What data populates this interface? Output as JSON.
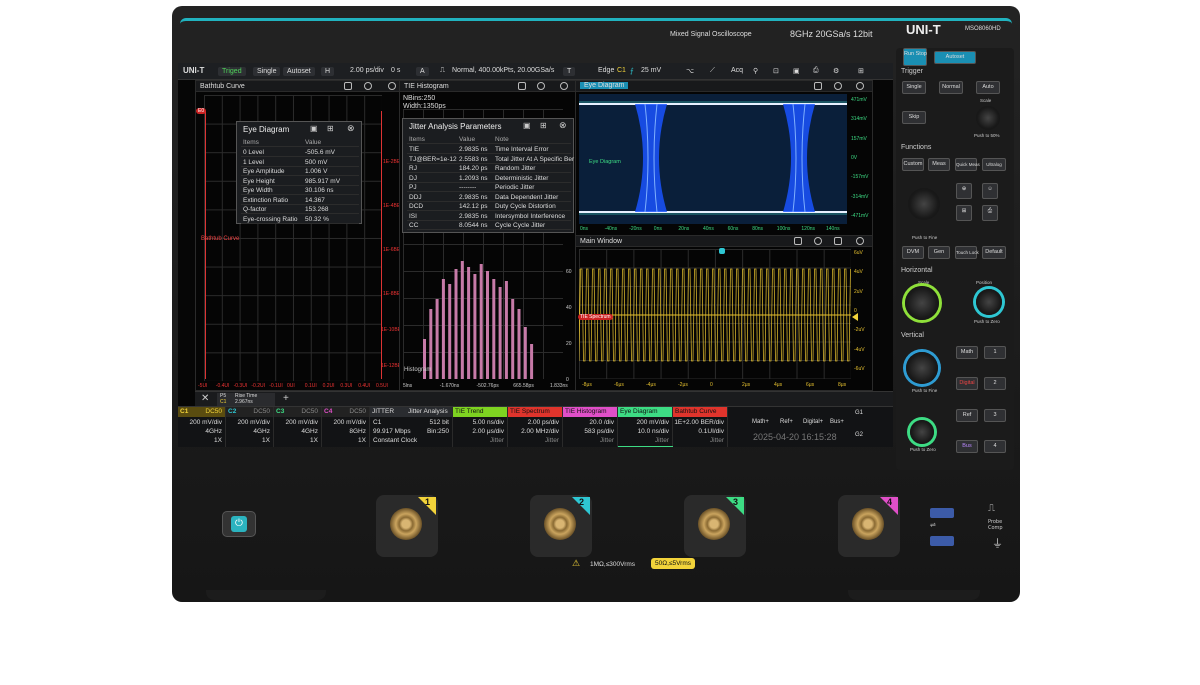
{
  "device": {
    "brand": "UNI-T",
    "model": "MSO8060HD",
    "tagline": "Mixed Signal Oscilloscope",
    "spec": "8GHz  20GSa/s  12bit",
    "warn_left": "1MΩ,≤300Vrms",
    "warn_right": "50Ω,≤5Vrms",
    "usb_icon": "usb-icon",
    "probe_comp": "Probe Comp"
  },
  "toolbar": {
    "logo": "UNI-T",
    "trigged": "Triged",
    "single": "Single",
    "autoset": "Autoset",
    "h_label": "H",
    "timebase": "2.00 ps/div",
    "offset": "0 s",
    "a_label": "A",
    "acq": "Normal, 400.00kPts, 20.00GSa/s",
    "t_label": "T",
    "edge": "Edge",
    "edge_ch": "C1",
    "trig_level": "25 mV",
    "acq_btn": "Acq"
  },
  "bathtub": {
    "title": "Bathtub Curve",
    "curve_label": "Bathtub Curve",
    "marker": "E0",
    "y_ticks": [
      "1E-2BER",
      "1E-4BER",
      "1E-6BER",
      "1E-8BER",
      "1E-10BER",
      "1E-12BER"
    ],
    "x_ticks": [
      "-5UI",
      "-0.4UI",
      "-0.3UI",
      "-0.2UI",
      "-0.1UI",
      "0UI",
      "0.1UI",
      "0.2UI",
      "0.3UI",
      "0.4UI",
      "0.5UI"
    ]
  },
  "eye_params": {
    "title": "Eye Diagram",
    "col1": "Items",
    "col2": "Value",
    "rows": [
      [
        "0 Level",
        "-505.6 mV"
      ],
      [
        "1 Level",
        "500 mV"
      ],
      [
        "Eye Amplitude",
        "1.006 V"
      ],
      [
        "Eye Height",
        "985.917 mV"
      ],
      [
        "Eye Width",
        "30.106 ns"
      ],
      [
        "Extinction Ratio",
        "14.367"
      ],
      [
        "Q-factor",
        "153.268"
      ],
      [
        "Eye-crossing Ratio",
        "50.32 %"
      ]
    ]
  },
  "tie_hist": {
    "title": "TIE Histogram",
    "nbins": "NBins:250",
    "width": "Width:1350ps",
    "label": "Histogram",
    "y_ticks": [
      "60",
      "40",
      "20",
      "0"
    ],
    "x_ticks": [
      "5lns",
      "-1.670ns",
      "-502.76ps",
      "665.58ps",
      "1.833ns"
    ]
  },
  "jitter": {
    "title": "Jitter Analysis Parameters",
    "cols": [
      "Items",
      "Value",
      "Note"
    ],
    "rows": [
      [
        "TIE",
        "2.9835 ns",
        "Time Interval Error"
      ],
      [
        "TJ@BER=1e-12",
        "2.5583 ns",
        "Total Jitter At A Specific Ber"
      ],
      [
        "RJ",
        "184.20 ps",
        "Random Jitter"
      ],
      [
        "DJ",
        "1.2093 ns",
        "Deterministic Jitter"
      ],
      [
        "PJ",
        "--------",
        "Periodic Jitter"
      ],
      [
        "DDJ",
        "2.9835 ns",
        "Data Dependent Jitter"
      ],
      [
        "DCD",
        "142.12 ps",
        "Duty Cycle Distortion"
      ],
      [
        "ISI",
        "2.9835 ns",
        "Intersymbol Interference"
      ],
      [
        "CC",
        "8.0544 ns",
        "Cycle Cycle Jitter"
      ]
    ]
  },
  "eye": {
    "title": "Eye Diagram",
    "label": "Eye Diagram",
    "y_ticks": [
      "471mV",
      "314mV",
      "157mV",
      "0V",
      "-157mV",
      "-314mV",
      "-471mV"
    ],
    "x_ticks": [
      "0ns",
      "-40ns",
      "-20ns",
      "0ns",
      "20ns",
      "40ns",
      "60ns",
      "80ns",
      "100ns",
      "120ns",
      "140ns"
    ]
  },
  "main": {
    "title": "Main Window",
    "marker": "TIE Spectrum",
    "y_ticks": [
      "6uV",
      "4uV",
      "2uV",
      "0",
      "-2uV",
      "-4uV",
      "-6uV"
    ],
    "x_ticks": [
      "-8μs",
      "-6μs",
      "-4μs",
      "-2μs",
      "0",
      "2μs",
      "4μs",
      "6μs",
      "8μs"
    ]
  },
  "tabs": {
    "p5": "P5",
    "c1": "C1",
    "rise": "Rise Time",
    "rise_val": "2.967ns"
  },
  "channels": [
    {
      "name": "C1",
      "mode": "DC50",
      "scale": "200 mV/div",
      "bw": "4GHz",
      "probe": "1X",
      "color": "#f2d33a"
    },
    {
      "name": "C2",
      "mode": "DC50",
      "scale": "200 mV/div",
      "bw": "4GHz",
      "probe": "1X",
      "color": "#2ec7d3"
    },
    {
      "name": "C3",
      "mode": "DC50",
      "scale": "200 mV/div",
      "bw": "4GHz",
      "probe": "1X",
      "color": "#3ddc84"
    },
    {
      "name": "C4",
      "mode": "DC50",
      "scale": "200 mV/div",
      "bw": "8GHz",
      "probe": "1X",
      "color": "#e04fc8"
    }
  ],
  "jitter_box": {
    "name": "JITTER",
    "title": "Jitter Analysis",
    "src": "C1",
    "bits": "512 bit",
    "rate": "99.917 Mbps",
    "bin": "Bin:250",
    "clock": "Constant Clock"
  },
  "mathboxes": [
    {
      "name": "TIE Trend",
      "l1": "5.00 ns/div",
      "l2": "2.00 μs/div",
      "l3": "Jitter",
      "color": "#7ed321"
    },
    {
      "name": "TIE Spectrum",
      "l1": "2.00 ps/div",
      "l2": "2.00 MHz/div",
      "l3": "Jitter",
      "color": "#e0342c"
    },
    {
      "name": "TIE Histogram",
      "l1": "20.0 /div",
      "l2": "583 ps/div",
      "l3": "Jitter",
      "color": "#e04fc8"
    },
    {
      "name": "Eye Diagram",
      "l1": "200 mV/div",
      "l2": "10.0 ns/div",
      "l3": "Jitter",
      "color": "#3ddc84"
    },
    {
      "name": "Bathtub Curve",
      "l1": "1E+2.00 BER/div",
      "l2": "0.1UI/div",
      "l3": "Jitter",
      "color": "#e0342c"
    }
  ],
  "right_buttons": {
    "math": "Math+",
    "ref": "Ref+",
    "digital": "Digital+",
    "bus": "Bus+",
    "g1": "G1",
    "g2": "G2",
    "datetime": "2025-04-20  16:15:28"
  },
  "front": {
    "run": "Run Stop",
    "autoset": "Autoset",
    "trigger": "Trigger",
    "single": "Single",
    "normal": "Normal",
    "auto": "Auto",
    "skip": "Skip",
    "scale": "Scale",
    "push50": "Push to 50%",
    "functions": "Functions",
    "custom": "Custom",
    "meas": "Meas",
    "quick": "Quick Meas",
    "ultra": "Ultralog",
    "pushfine": "Push to Fine",
    "dvm": "DVM",
    "gen": "Gen",
    "touch": "Touch Lock",
    "default": "Default",
    "horizontal": "Horizontal",
    "pushzero": "Push to Zero",
    "position": "Position",
    "vertical": "Vertical",
    "math": "Math",
    "digital": "Digital",
    "ref": "Ref",
    "bus": "Bus",
    "n1": "1",
    "n2": "2",
    "n3": "3",
    "n4": "4",
    "inputs": [
      "1",
      "2",
      "3",
      "4"
    ]
  },
  "colors": {
    "accent": "#21b3bf",
    "c1": "#f2d33a",
    "c2": "#2ec7d3",
    "c3": "#3ddc84",
    "c4": "#e04fc8"
  }
}
